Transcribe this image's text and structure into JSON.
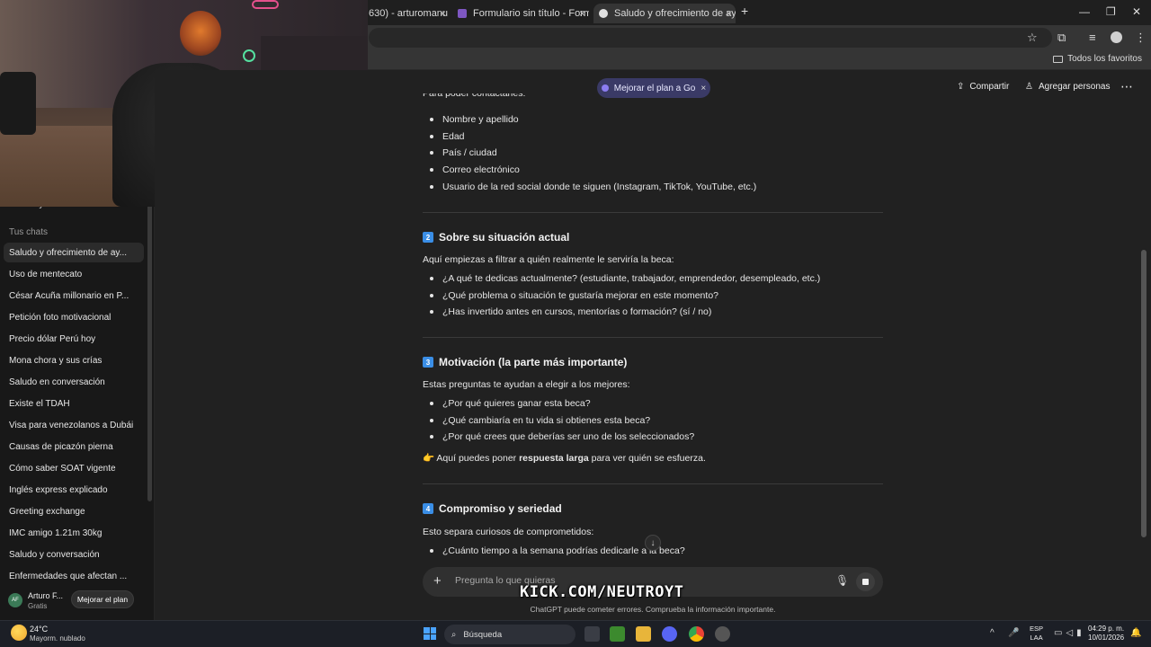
{
  "browser": {
    "tabs": [
      {
        "label": "630) - arturomanu",
        "active": false
      },
      {
        "label": "Formulario sin título - Formular",
        "active": false
      },
      {
        "label": "Saludo y ofrecimiento de ayuda",
        "active": true
      }
    ],
    "bookmarks_all": "Todos los favoritos"
  },
  "sidebar": {
    "projects_label": "Proyectos",
    "chats_heading": "Tus chats",
    "chats": [
      "Saludo y ofrecimiento de ay...",
      "Uso de mentecato",
      "César Acuña millonario en P...",
      "Petición foto motivacional",
      "Precio dólar Perú hoy",
      "Mona chora y sus crías",
      "Saludo en conversación",
      "Existe el TDAH",
      "Visa para venezolanos a Dubái",
      "Causas de picazón pierna",
      "Cómo saber SOAT vigente",
      "Inglés express explicado",
      "Greeting exchange",
      "IMC amigo 1.21m 30kg",
      "Saludo y conversación",
      "Enfermedades que afectan ..."
    ],
    "user": {
      "initials": "AF",
      "name": "Arturo F...",
      "plan": "Gratis",
      "upgrade_label": "Mejorar el plan"
    }
  },
  "header": {
    "plan_pill": "Mejorar el plan a Go",
    "plan_close": "×",
    "share_label": "Compartir",
    "add_people_label": "Agregar personas",
    "more_label": "⋯"
  },
  "content": {
    "intro_partial": "Para poder contactarles:",
    "list1": [
      "Nombre y apellido",
      "Edad",
      "País / ciudad",
      "Correo electrónico",
      "Usuario de la red social donde te siguen (Instagram, TikTok, YouTube, etc.)"
    ],
    "section2": {
      "num": "2",
      "title": "Sobre su situación actual",
      "intro": "Aquí empiezas a filtrar a quién realmente le serviría la beca:",
      "items": [
        "¿A qué te dedicas actualmente? (estudiante, trabajador, emprendedor, desempleado, etc.)",
        "¿Qué problema o situación te gustaría mejorar en este momento?",
        "¿Has invertido antes en cursos, mentorías o formación? (sí / no)"
      ]
    },
    "section3": {
      "num": "3",
      "title": "Motivación (la parte más importante)",
      "intro": "Estas preguntas te ayudan a elegir a los mejores:",
      "items": [
        "¿Por qué quieres ganar esta beca?",
        "¿Qué cambiaría en tu vida si obtienes esta beca?",
        "¿Por qué crees que deberías ser uno de los seleccionados?"
      ],
      "note_emoji": "👉",
      "note_pre": "Aquí puedes poner ",
      "note_bold": "respuesta larga",
      "note_post": " para ver quién se esfuerza."
    },
    "section4": {
      "num": "4",
      "title": "Compromiso y seriedad",
      "intro": "Esto separa curiosos de comprometidos:",
      "items": [
        "¿Cuánto tiempo a la semana podrías dedicarle a la beca?"
      ]
    }
  },
  "composer": {
    "placeholder": "Pregunta lo que quieras",
    "overlay": "KICK.COM/NEUTROYT",
    "disclaimer": "ChatGPT puede cometer errores. Comprueba la información importante."
  },
  "taskbar": {
    "weather_temp": "24°C",
    "weather_desc": "Mayorm. nublado",
    "search_label": "Búsqueda",
    "lang_top": "ESP",
    "lang_bottom": "LAA",
    "time": "04:29 p. m.",
    "date": "10/01/2026"
  },
  "colors": {
    "accent": "#3a8ee6",
    "pill": "#3a3a66",
    "background": "#212121"
  }
}
